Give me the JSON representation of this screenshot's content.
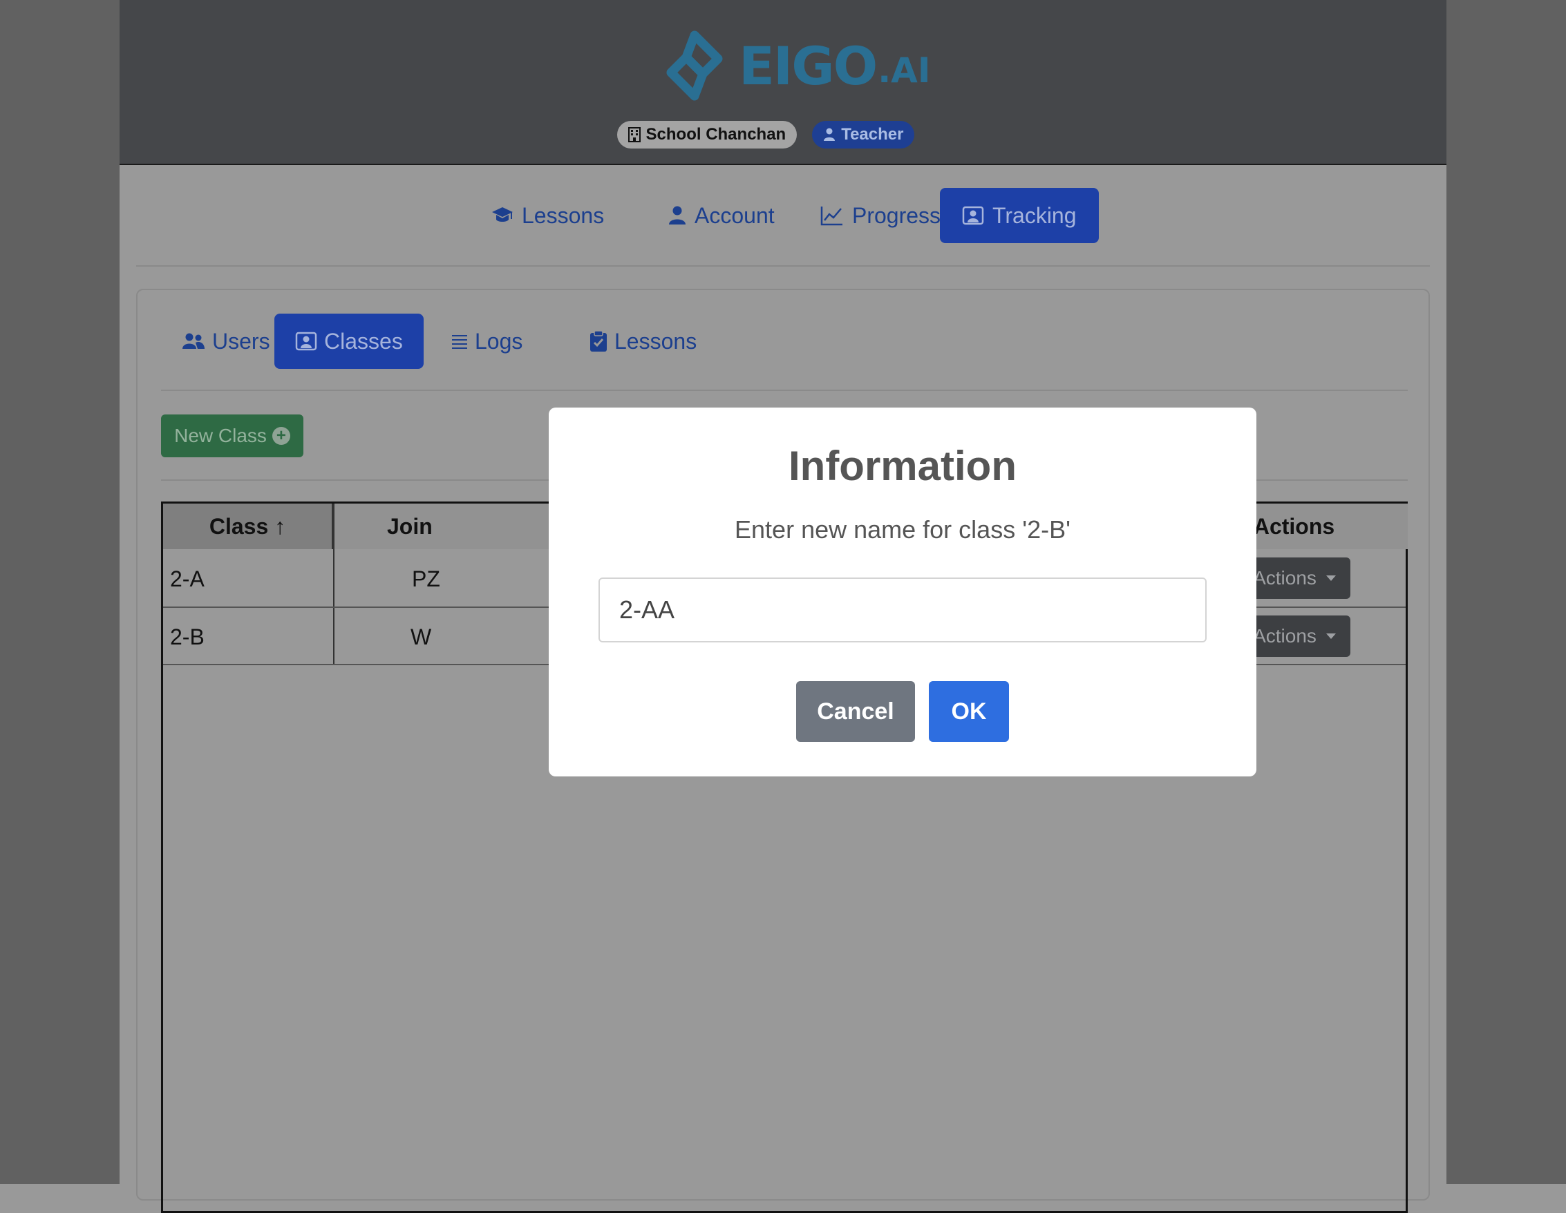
{
  "header": {
    "logo_text": "EIGO",
    "logo_suffix": ".AI",
    "school_badge": "School Chanchan",
    "role_badge": "Teacher"
  },
  "main_nav": [
    {
      "label": "Lessons",
      "icon": "graduation-cap-icon",
      "active": false
    },
    {
      "label": "Account",
      "icon": "user-icon",
      "active": false
    },
    {
      "label": "Progress",
      "icon": "chart-line-icon",
      "active": false
    },
    {
      "label": "Tracking",
      "icon": "id-badge-icon",
      "active": true
    }
  ],
  "sub_nav": [
    {
      "label": "Users",
      "icon": "users-icon",
      "active": false
    },
    {
      "label": "Classes",
      "icon": "id-badge-icon",
      "active": true
    },
    {
      "label": "Logs",
      "icon": "list-icon",
      "active": false
    },
    {
      "label": "Lessons",
      "icon": "clipboard-check-icon",
      "active": false
    }
  ],
  "new_class_button": "New Class",
  "table": {
    "headers": {
      "class": "Class ↑",
      "join": "Join",
      "actions": "Actions"
    },
    "rows": [
      {
        "class": "2-A",
        "join": "PZ",
        "action": "Actions"
      },
      {
        "class": "2-B",
        "join": "W",
        "action": "Actions"
      }
    ]
  },
  "modal": {
    "title": "Information",
    "message": "Enter new name for class '2-B'",
    "input_value": "2-AA",
    "cancel_label": "Cancel",
    "ok_label": "OK"
  },
  "colors": {
    "accent": "#2e6ee0",
    "nav_active": "#1d40a7",
    "success": "#2e6a44",
    "logo": "#2a6f93"
  }
}
